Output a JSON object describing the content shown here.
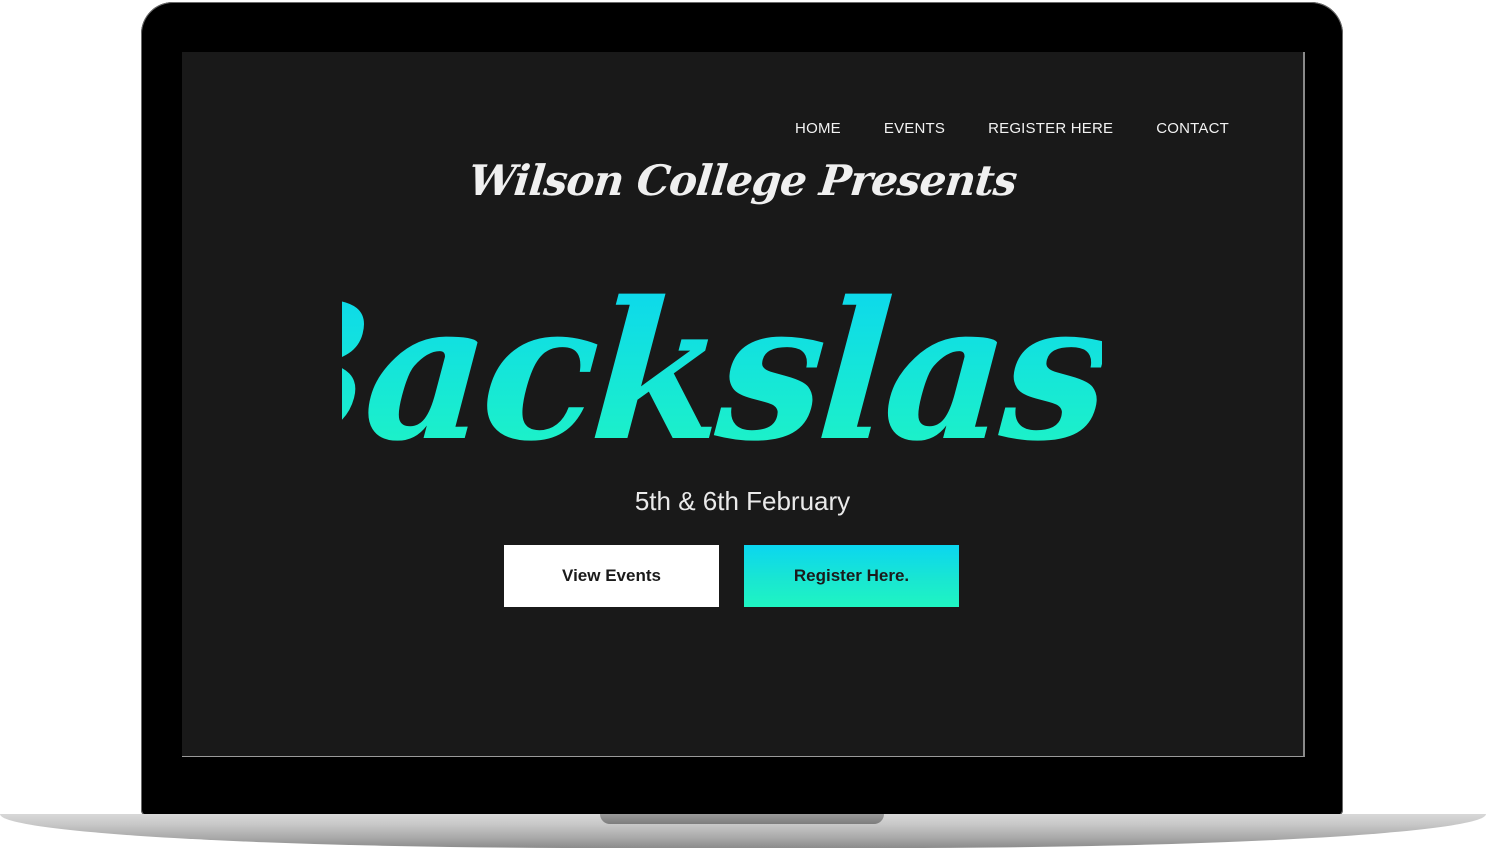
{
  "nav": {
    "items": [
      {
        "label": "HOME"
      },
      {
        "label": "EVENTS"
      },
      {
        "label": "REGISTER HERE"
      },
      {
        "label": "CONTACT"
      }
    ]
  },
  "hero": {
    "presenter": "Wilson College Presents",
    "title": "Backslash",
    "date": "5th & 6th February",
    "title_gradient": [
      "#0ad4f2",
      "#20f7c0"
    ]
  },
  "buttons": {
    "view_events": "View Events",
    "register": "Register Here."
  },
  "colors": {
    "screen_bg": "#191919",
    "accent_top": "#0bd6f0",
    "accent_bottom": "#1ff5c2"
  }
}
